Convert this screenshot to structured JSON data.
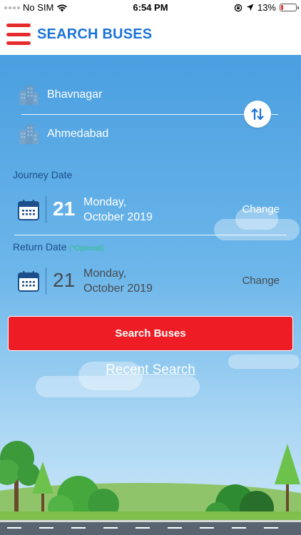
{
  "status_bar": {
    "carrier": "No SIM",
    "time": "6:54 PM",
    "battery_percent": "13%",
    "battery_level": 0.13,
    "battery_color": "#e53935",
    "icons": [
      "signal-dots-icon",
      "wifi-icon",
      "orientation-lock-icon",
      "location-arrow-icon",
      "battery-icon"
    ]
  },
  "header": {
    "title": "SEARCH BUSES",
    "menu_icon": "hamburger-menu-icon",
    "title_color": "#1a73d9",
    "menu_color": "#e52b2b"
  },
  "route": {
    "from_city": "Bhavnagar",
    "to_city": "Ahmedabad",
    "city_icon": "city-building-icon",
    "swap_icon": "swap-arrows-icon"
  },
  "journey": {
    "label": "Journey Date",
    "day": "21",
    "weekday": "Monday,",
    "month_year": "October 2019",
    "change_label": "Change",
    "icon": "calendar-icon"
  },
  "return": {
    "label": "Return Date",
    "optional_note": "(*Optional)",
    "day": "21",
    "weekday": "Monday,",
    "month_year": "October 2019",
    "change_label": "Change",
    "icon": "calendar-icon"
  },
  "actions": {
    "search_label": "Search Buses",
    "search_color": "#ee1c25",
    "recent_label": "Recent Search"
  }
}
